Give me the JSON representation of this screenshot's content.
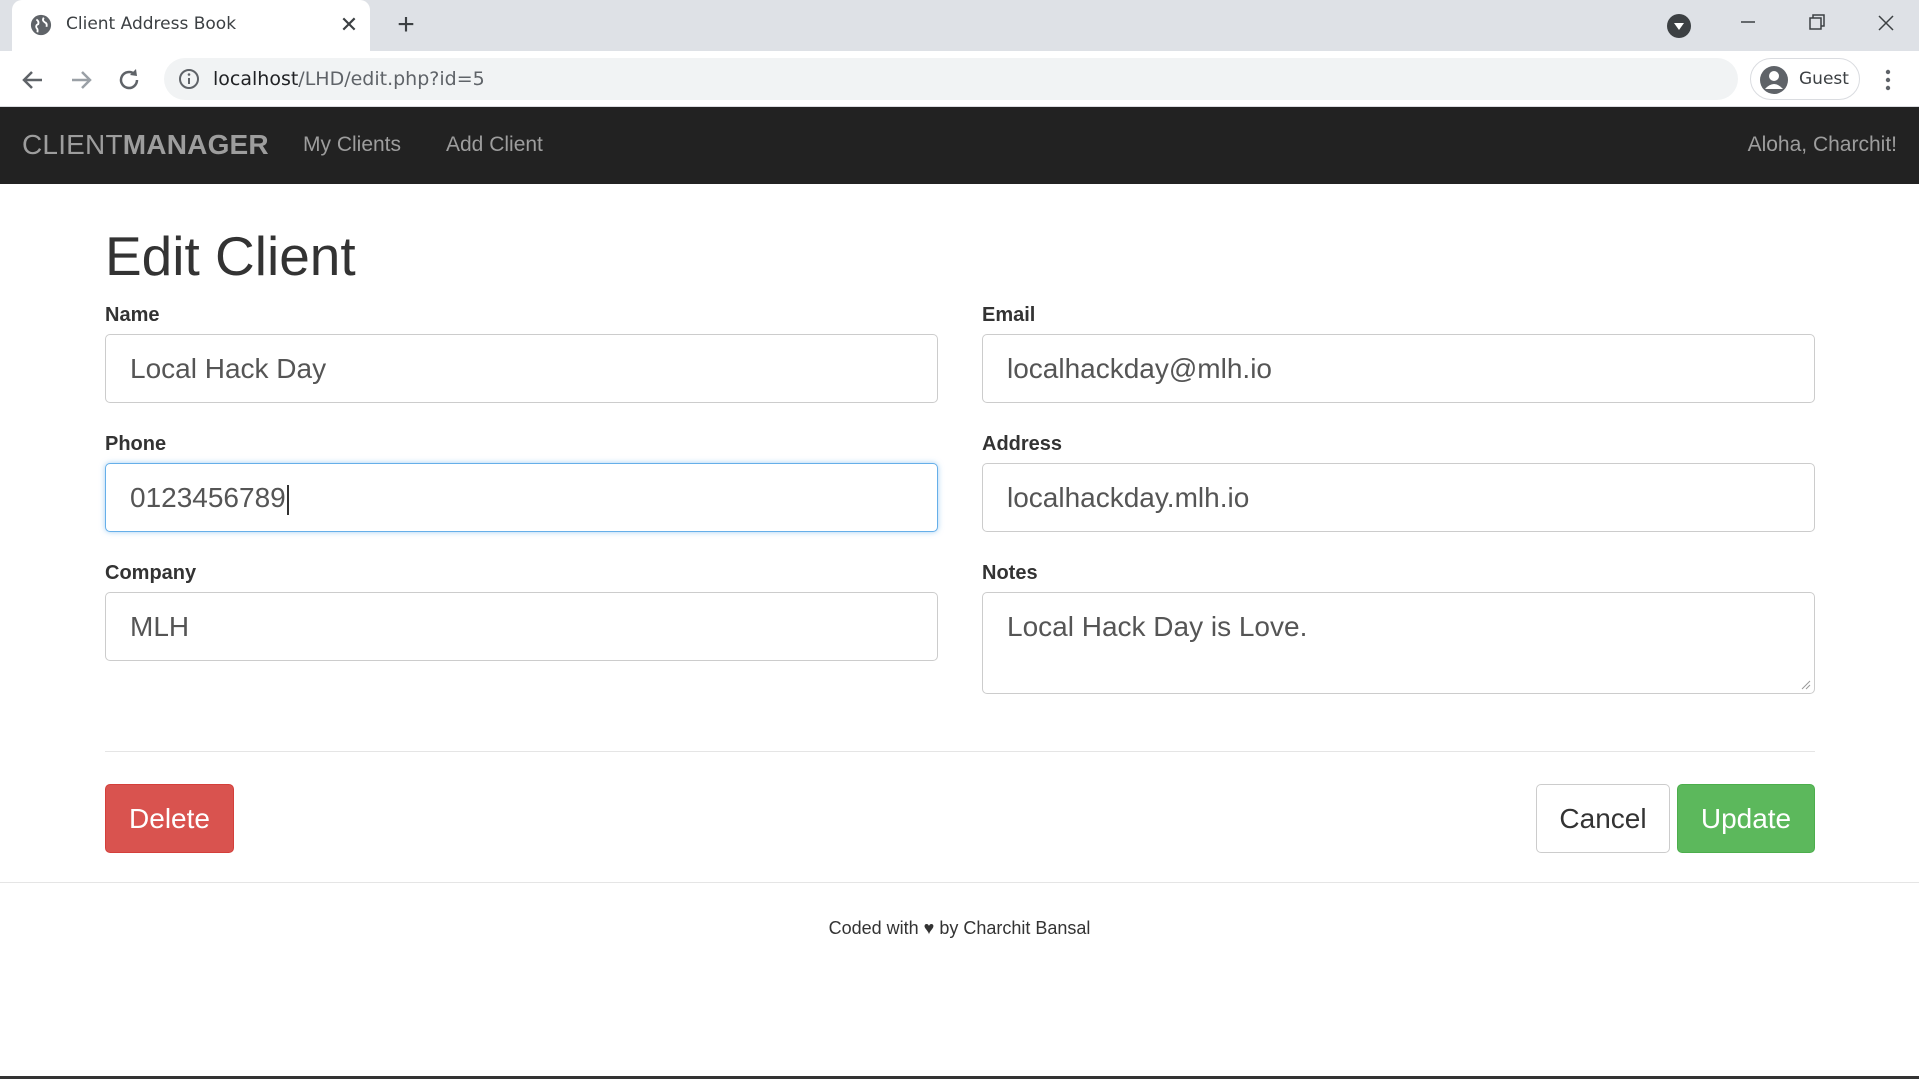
{
  "browser": {
    "tab_title": "Client Address Book",
    "tab_close": "✕",
    "new_tab": "+",
    "url_host": "localhost",
    "url_path": "/LHD/edit.php?id=5",
    "profile_label": "Guest",
    "window_minimize": "—",
    "window_restore": "❐",
    "window_close": "✕"
  },
  "navbar": {
    "brand_light": "CLIENT",
    "brand_bold": "MANAGER",
    "links": [
      {
        "label": "My Clients"
      },
      {
        "label": "Add Client"
      }
    ],
    "greeting": "Aloha, Charchit!"
  },
  "form": {
    "title": "Edit Client",
    "name": {
      "label": "Name",
      "value": "Local Hack Day"
    },
    "email": {
      "label": "Email",
      "value": "localhackday@mlh.io"
    },
    "phone": {
      "label": "Phone",
      "value": "0123456789"
    },
    "address": {
      "label": "Address",
      "value": "localhackday.mlh.io"
    },
    "company": {
      "label": "Company",
      "value": "MLH"
    },
    "notes": {
      "label": "Notes",
      "value": "Local Hack Day is Love."
    }
  },
  "buttons": {
    "delete": "Delete",
    "cancel": "Cancel",
    "update": "Update"
  },
  "footer": {
    "text": "Coded with ♥ by Charchit Bansal"
  },
  "colors": {
    "navbar_bg": "#222222",
    "delete": "#d9534f",
    "update": "#5cb85c",
    "focus_border": "#66afe9"
  }
}
